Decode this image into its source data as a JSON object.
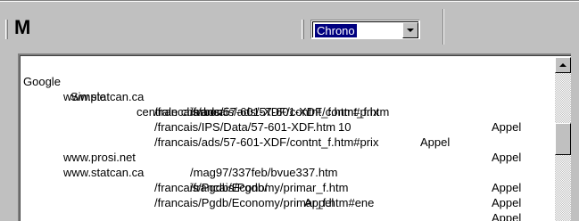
{
  "toolbar": {
    "letter": "M",
    "combo_value": "Chrono"
  },
  "list": {
    "rows": [
      {
        "cols": [
          "Google",
          "Simple",
          "centrale charbon",
          "10"
        ]
      },
      {
        "cols": [
          "www.statcan.ca",
          "/francais/ads/57-601-XDF/contnt_f.htm"
        ]
      },
      {
        "cols": [
          "/francais/ads/57-601-XDF/contnt_f.htm#prix",
          "Appel"
        ]
      },
      {
        "cols": [
          "/francais/IPS/Data/57-601-XDF.htm",
          "Appel"
        ]
      },
      {
        "cols": [
          "/francais/ads/57-601-XDF/contnt_f.htm#prix",
          "Appel"
        ]
      },
      {
        "cols": [
          "www.prosi.net",
          "/mag97/337feb/bvue337.htm",
          "Appel"
        ]
      },
      {
        "cols": [
          "www.statcan.ca",
          "/francais/Pgdb/",
          "Appel"
        ]
      },
      {
        "cols": [
          "/francais/Pgdb/Economy/primar_f.htm",
          "Appel"
        ]
      },
      {
        "cols": [
          "/francais/Pgdb/Economy/primar_f.htm#ene",
          "Appel"
        ]
      }
    ]
  }
}
